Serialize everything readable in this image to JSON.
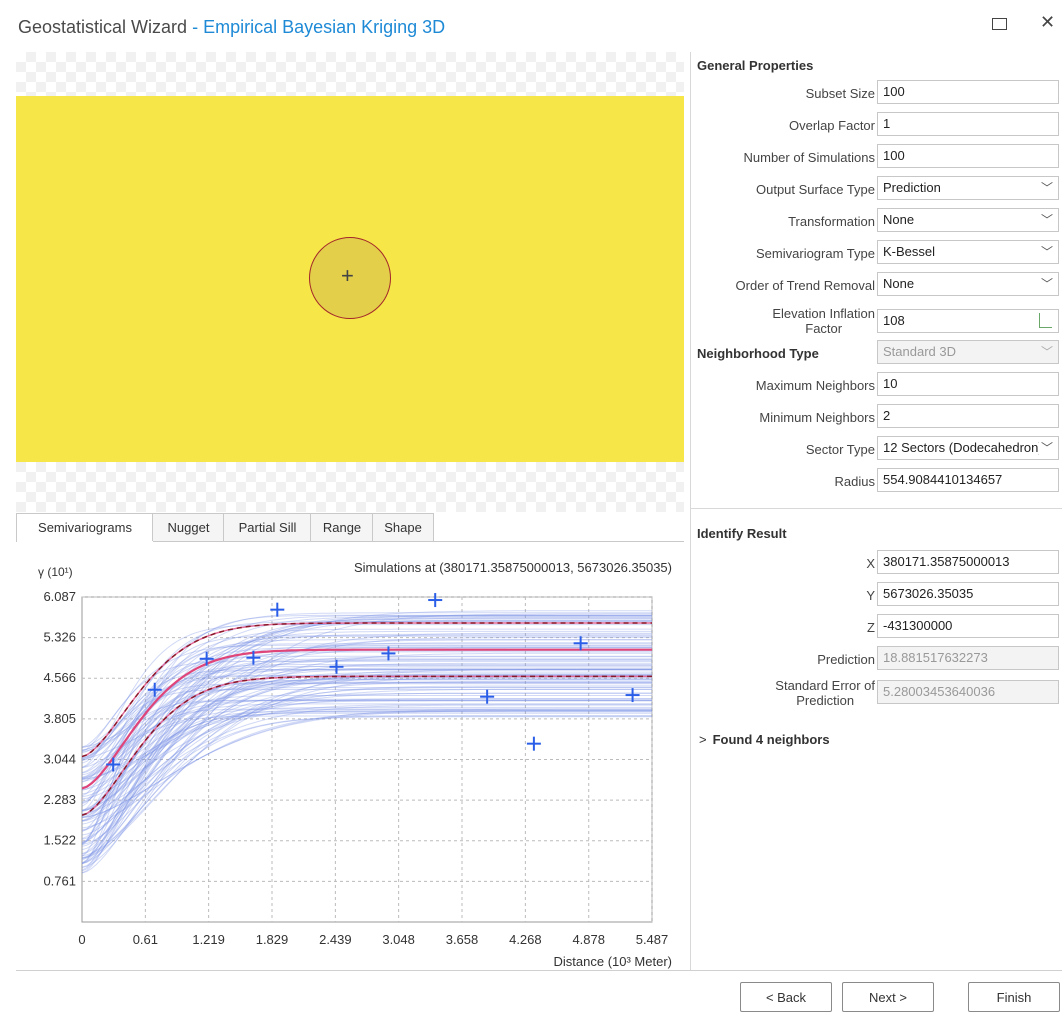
{
  "window": {
    "title": "Geostatistical Wizard",
    "separator": " - ",
    "subtitle": "Empirical Bayesian Kriging 3D"
  },
  "tabs": [
    {
      "label": "Semivariograms",
      "active": true
    },
    {
      "label": "Nugget",
      "active": false
    },
    {
      "label": "Partial Sill",
      "active": false
    },
    {
      "label": "Range",
      "active": false
    },
    {
      "label": "Shape",
      "active": false
    }
  ],
  "general_properties": {
    "heading": "General Properties",
    "subset_size": {
      "label": "Subset Size",
      "value": "100"
    },
    "overlap_factor": {
      "label": "Overlap Factor",
      "value": "1"
    },
    "num_simulations": {
      "label": "Number of Simulations",
      "value": "100"
    },
    "output_surface_type": {
      "label": "Output Surface Type",
      "value": "Prediction"
    },
    "transformation": {
      "label": "Transformation",
      "value": "None"
    },
    "semivariogram_type": {
      "label": "Semivariogram Type",
      "value": "K-Bessel"
    },
    "order_trend_removal": {
      "label": "Order of Trend Removal",
      "value": "None"
    },
    "elevation_inflation": {
      "label_line1": "Elevation Inflation",
      "label_line2": "Factor",
      "value": "108"
    }
  },
  "neighborhood": {
    "heading": "Neighborhood Type",
    "type_value": "Standard 3D",
    "max_neighbors": {
      "label": "Maximum Neighbors",
      "value": "10"
    },
    "min_neighbors": {
      "label": "Minimum Neighbors",
      "value": "2"
    },
    "sector_type": {
      "label": "Sector Type",
      "value": "12 Sectors (Dodecahedron)"
    },
    "radius": {
      "label": "Radius",
      "value": "554.9084410134657"
    }
  },
  "identify_result": {
    "heading": "Identify Result",
    "x": {
      "label": "X",
      "value": "380171.35875000013"
    },
    "y": {
      "label": "Y",
      "value": "5673026.35035"
    },
    "z": {
      "label": "Z",
      "value": "-431300000"
    },
    "prediction": {
      "label": "Prediction",
      "value": "18.881517632273"
    },
    "std_error": {
      "label_line1": "Standard Error of",
      "label_line2": "Prediction",
      "value": "5.28003453640036"
    },
    "found": "Found 4 neighbors",
    "found_chevron": ">"
  },
  "buttons": {
    "back": "< Back",
    "next": "Next >",
    "finish": "Finish"
  },
  "colors": {
    "accent": "#1e8ad6",
    "map_fill": "#f7e648",
    "curve_blue": "#7b93e6",
    "curve_pink": "#e0457a",
    "quantile_dash": "#8a1a2a",
    "point_plus": "#2a5ee8"
  },
  "chart_data": {
    "type": "line",
    "title": "Simulations at (380171.35875000013, 5673026.35035)",
    "ylabel": "γ (10¹)",
    "xlabel": "Distance (10³ Meter)",
    "x_ticks": [
      "0",
      "0.61",
      "1.219",
      "1.829",
      "2.439",
      "3.048",
      "3.658",
      "4.268",
      "4.878",
      "5.487"
    ],
    "y_ticks": [
      "0.761",
      "1.522",
      "2.283",
      "3.044",
      "3.805",
      "4.566",
      "5.326",
      "6.087"
    ],
    "xlim": [
      0,
      5.487
    ],
    "ylim": [
      0,
      6.087
    ],
    "grid": true,
    "empirical_points": [
      {
        "x": 0.3,
        "y": 2.95
      },
      {
        "x": 0.7,
        "y": 4.35
      },
      {
        "x": 1.2,
        "y": 4.93
      },
      {
        "x": 1.65,
        "y": 4.95
      },
      {
        "x": 1.88,
        "y": 5.85
      },
      {
        "x": 2.45,
        "y": 4.78
      },
      {
        "x": 2.95,
        "y": 5.03
      },
      {
        "x": 3.4,
        "y": 6.03
      },
      {
        "x": 3.9,
        "y": 4.22
      },
      {
        "x": 4.35,
        "y": 3.34
      },
      {
        "x": 4.8,
        "y": 5.22
      },
      {
        "x": 5.3,
        "y": 4.25
      }
    ],
    "median_curve": {
      "nugget": 2.5,
      "sill": 5.1,
      "range": 1.3
    },
    "quantile_curves": [
      {
        "nugget": 3.1,
        "sill": 5.6,
        "range": 1.3
      },
      {
        "nugget": 2.0,
        "sill": 4.6,
        "range": 1.3
      }
    ],
    "num_simulations": 100
  }
}
